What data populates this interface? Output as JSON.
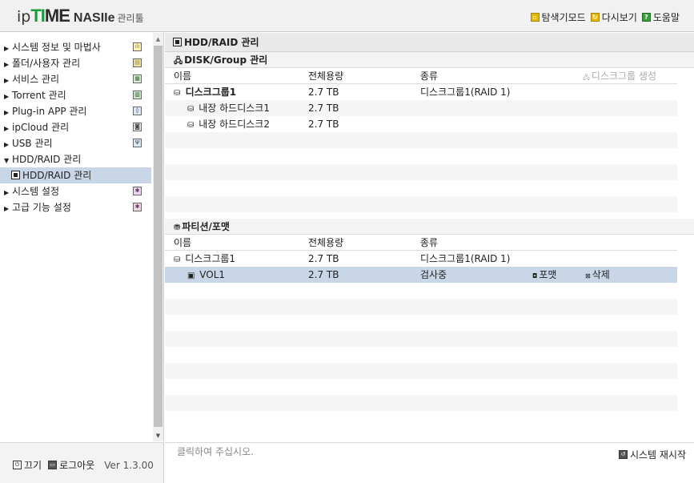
{
  "header": {
    "logo_ip": "ip",
    "logo_time_1": "T",
    "logo_time_2": "I",
    "logo_time_3": "ME",
    "logo_nas": "NASIIe",
    "logo_admin": "관리툴",
    "links": [
      {
        "label": "탐색기모드",
        "icon": "explorer-mode-icon"
      },
      {
        "label": "다시보기",
        "icon": "refresh-icon"
      },
      {
        "label": "도움말",
        "icon": "help-icon"
      }
    ]
  },
  "sidebar": {
    "items": [
      {
        "label": "시스템 정보 및 마법사",
        "icon": "chart-icon"
      },
      {
        "label": "폴더/사용자 관리",
        "icon": "folder-icon"
      },
      {
        "label": "서비스 관리",
        "icon": "service-icon"
      },
      {
        "label": "Torrent 관리",
        "icon": "torrent-icon"
      },
      {
        "label": "Plug-in APP 관리",
        "icon": "plugin-icon"
      },
      {
        "label": "ipCloud 관리",
        "icon": "cloud-icon"
      },
      {
        "label": "USB 관리",
        "icon": "usb-icon"
      },
      {
        "label": "HDD/RAID 관리",
        "expanded": true
      },
      {
        "label": "HDD/RAID 관리",
        "sub": true,
        "selected": true
      },
      {
        "label": "시스템 설정",
        "icon": "settings-icon"
      },
      {
        "label": "고급 기능 설정",
        "icon": "advanced-icon"
      }
    ],
    "footer": {
      "power": "끄기",
      "logout": "로그아웃",
      "version": "Ver 1.3.00"
    }
  },
  "main": {
    "title": "HDD/RAID 관리",
    "disk_section": {
      "title": "DISK/Group 관리",
      "columns": [
        "이름",
        "전체용량",
        "종류"
      ],
      "create_button": "디스크그룹 생성",
      "rows": [
        {
          "name": "디스크그룹1",
          "size": "2.7 TB",
          "type": "디스크그룹1(RAID 1)"
        },
        {
          "name": "내장 하드디스크1",
          "size": "2.7 TB",
          "type": ""
        },
        {
          "name": "내장 하드디스크2",
          "size": "2.7 TB",
          "type": ""
        }
      ]
    },
    "partition_section": {
      "title": "파티션/포맷",
      "columns": [
        "이름",
        "전체용량",
        "종류"
      ],
      "rows": [
        {
          "name": "디스크그룹1",
          "size": "2.7 TB",
          "type": "디스크그룹1(RAID 1)"
        },
        {
          "name": "VOL1",
          "size": "2.7 TB",
          "type": "검사중",
          "format": "포맷",
          "delete": "삭제"
        }
      ]
    }
  },
  "status": {
    "message": "클릭하여 주십시오.",
    "restart": "시스템 재시작"
  },
  "colors": {
    "selection": "#c8d6e8",
    "logo_accent": "#1c9a3c"
  }
}
